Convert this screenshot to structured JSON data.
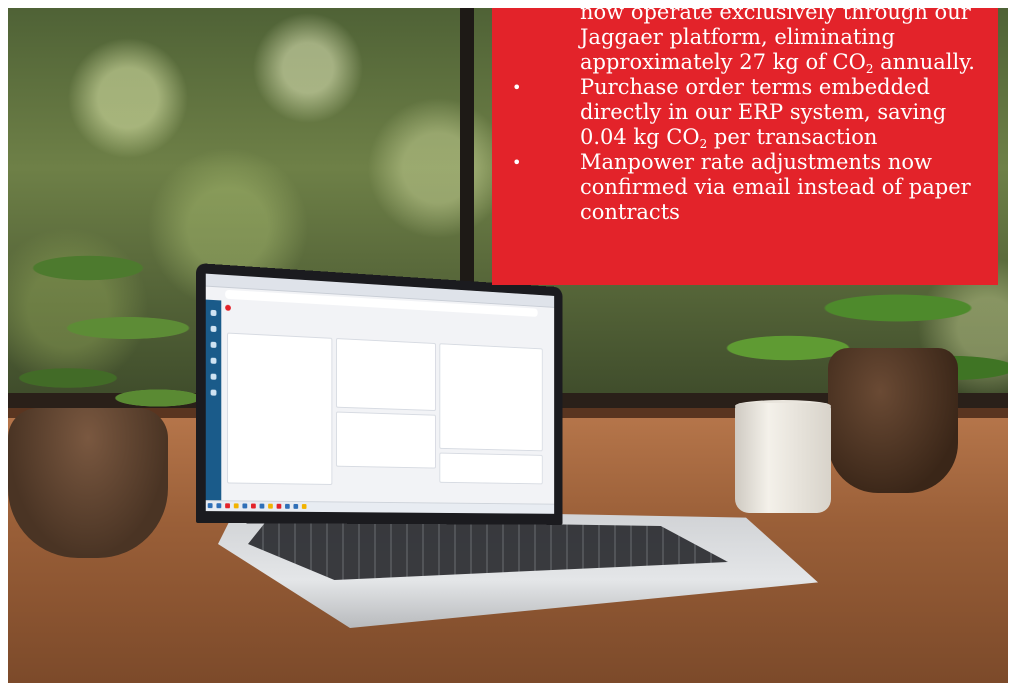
{
  "red_panel": {
    "continuation_text": [
      "now operate exclusively through our",
      "Jaggaer platform, eliminating",
      "approximately 27 kg of CO",
      "2",
      " annually."
    ],
    "bullets": [
      {
        "before_sub": "Purchase order terms embedded directly in our ERP system, saving 0.04 kg CO",
        "sub": "2",
        "after_sub": " per transaction"
      },
      {
        "before_sub": "Manpower rate adjustments now confirmed via email instead of paper contracts",
        "sub": "",
        "after_sub": ""
      }
    ],
    "background_color": "#e3232a",
    "text_color": "#ffffff"
  },
  "scene": {
    "icons": [
      "laptop-icon",
      "coffee-mug-icon",
      "potted-plant-icon"
    ]
  }
}
